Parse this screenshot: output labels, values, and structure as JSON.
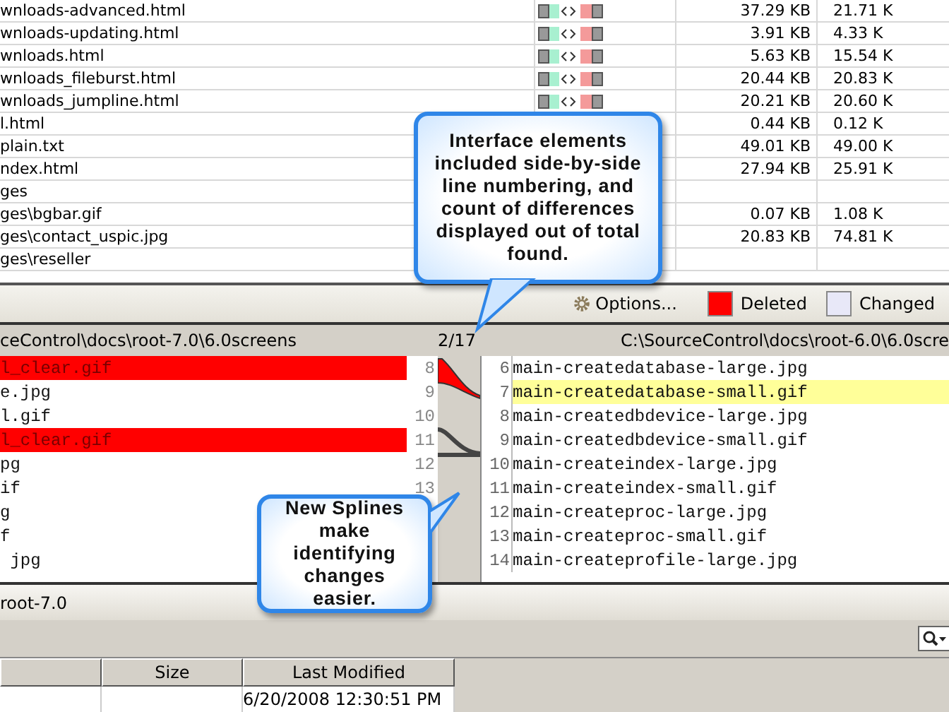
{
  "file_table": {
    "rows": [
      {
        "name": "wnloads-advanced.html",
        "left_size": "37.29 KB",
        "right_size": "21.71 K"
      },
      {
        "name": "wnloads-updating.html",
        "left_size": "3.91 KB",
        "right_size": "4.33 K"
      },
      {
        "name": "wnloads.html",
        "left_size": "5.63 KB",
        "right_size": "15.54 K"
      },
      {
        "name": "wnloads_fileburst.html",
        "left_size": "20.44 KB",
        "right_size": "20.83 K"
      },
      {
        "name": "wnloads_jumpline.html",
        "left_size": "20.21 KB",
        "right_size": "20.60 K"
      },
      {
        "name": "l.html",
        "left_size": "0.44 KB",
        "right_size": "0.12 K"
      },
      {
        "name": "plain.txt",
        "left_size": "49.01 KB",
        "right_size": "49.00 K"
      },
      {
        "name": "ndex.html",
        "left_size": "27.94 KB",
        "right_size": "25.91 K"
      },
      {
        "name": "ges"
      },
      {
        "name": "ges\\bgbar.gif",
        "left_size": "0.07 KB",
        "right_size": "1.08 K"
      },
      {
        "name": "ges\\contact_uspic.jpg",
        "left_size": "20.83 KB",
        "right_size": "74.81 K"
      },
      {
        "name": "ges\\reseller"
      }
    ]
  },
  "toolbar": {
    "options_button": "Options...",
    "legend": [
      {
        "label": "Deleted",
        "color": "#ff0000"
      },
      {
        "label": "Changed",
        "color": "#e8e8f8"
      }
    ]
  },
  "diff": {
    "left_path": "ceControl\\docs\\root-7.0\\6.0screens",
    "counter": "2/17",
    "right_path": "C:\\SourceControl\\docs\\root-6.0\\6.0scre",
    "left_lines": [
      {
        "text": "l_clear.gif",
        "number": "8",
        "kind": "deleted"
      },
      {
        "text": "e.jpg",
        "number": "9",
        "kind": "normal"
      },
      {
        "text": "l.gif",
        "number": "10",
        "kind": "normal"
      },
      {
        "text": "l_clear.gif",
        "number": "11",
        "kind": "deleted"
      },
      {
        "text": "pg",
        "number": "12",
        "kind": "normal"
      },
      {
        "text": "if",
        "number": "13",
        "kind": "normal"
      },
      {
        "text": "g",
        "kind": "normal"
      },
      {
        "text": "f",
        "kind": "normal"
      },
      {
        "text": " jpg",
        "kind": "normal"
      }
    ],
    "right_lines": [
      {
        "text": "main-createdatabase-large.jpg",
        "number": "6",
        "kind": "normal"
      },
      {
        "text": "main-createdatabase-small.gif",
        "number": "7",
        "kind": "changed"
      },
      {
        "text": "main-createdbdevice-large.jpg",
        "number": "8",
        "kind": "normal"
      },
      {
        "text": "main-createdbdevice-small.gif",
        "number": "9",
        "kind": "normal"
      },
      {
        "text": "main-createindex-large.jpg",
        "number": "10",
        "kind": "normal"
      },
      {
        "text": "main-createindex-small.gif",
        "number": "11",
        "kind": "normal"
      },
      {
        "text": "main-createproc-large.jpg",
        "number": "12",
        "kind": "normal"
      },
      {
        "text": "main-createproc-small.gif",
        "number": "13",
        "kind": "normal"
      },
      {
        "text": "main-createprofile-large.jpg",
        "number": "14",
        "kind": "normal"
      }
    ]
  },
  "bottom_panel": {
    "title": "root-7.0",
    "columns": [
      "",
      "Size",
      "Last Modified"
    ],
    "rows": [
      [
        "",
        "",
        "6/20/2008 12:30:51 PM"
      ]
    ]
  },
  "callouts": [
    {
      "text": "Interface elements included side-by-side line numbering, and count of differences displayed out of total found."
    },
    {
      "text": "New Splines make identifying changes easier."
    }
  ]
}
